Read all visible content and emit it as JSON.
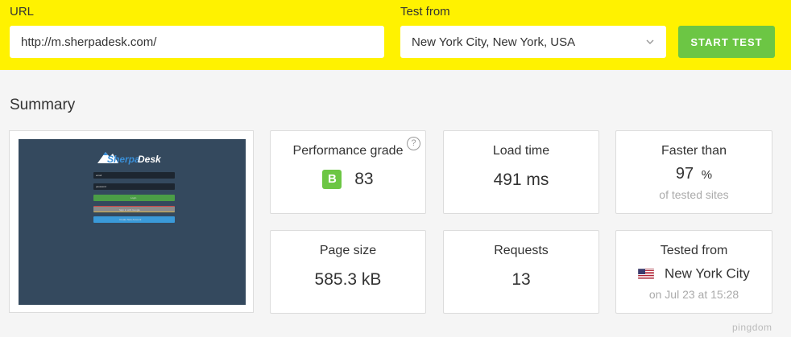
{
  "form": {
    "url_label": "URL",
    "url_value": "http://m.sherpadesk.com/",
    "test_from_label": "Test from",
    "test_from_value": "New York City, New York, USA",
    "start_button": "START TEST"
  },
  "summary": {
    "title": "Summary",
    "thumbnail": {
      "logo_text_a": "Sherpa",
      "logo_text_b": "Desk",
      "email_field": "email",
      "password_field": "password",
      "login_button": "Login",
      "google_button": "Sign in with Google",
      "create_button": "Create New Account"
    },
    "performance": {
      "label": "Performance grade",
      "grade": "B",
      "score": "83",
      "help": "?"
    },
    "load_time": {
      "label": "Load time",
      "value": "491 ms"
    },
    "faster_than": {
      "label": "Faster than",
      "value": "97",
      "unit": "%",
      "sub": "of tested sites"
    },
    "page_size": {
      "label": "Page size",
      "value": "585.3 kB"
    },
    "requests": {
      "label": "Requests",
      "value": "13"
    },
    "tested_from": {
      "label": "Tested from",
      "city": "New York City",
      "date": "on Jul 23 at 15:28"
    }
  },
  "branding": {
    "pingdom": "pingdom"
  },
  "colors": {
    "topbar": "#fff200",
    "accent_green": "#6cc644",
    "thumbnail_bg": "#34495e"
  },
  "icons": {
    "select_arrow": "chevron-down-icon",
    "help": "help-icon",
    "flag": "us-flag-icon"
  }
}
